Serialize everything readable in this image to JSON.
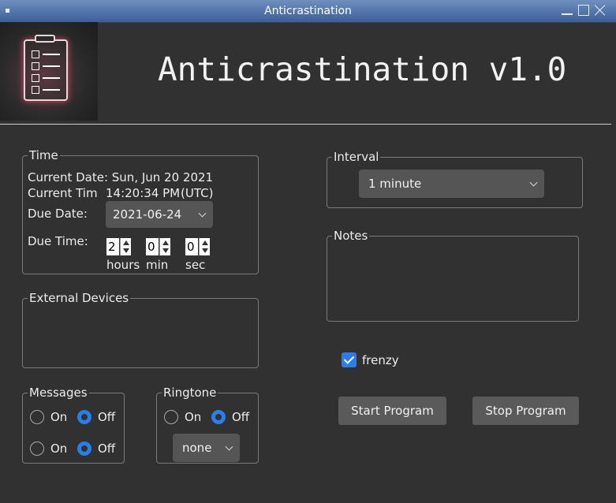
{
  "window": {
    "title": "Anticrastination"
  },
  "header": {
    "app_title": "Anticrastination v1.0",
    "logo_icon": "clipboard-checklist-icon"
  },
  "time": {
    "group_label": "Time",
    "current_date": "Current Date: Sun, Jun 20 2021",
    "current_time_label": "Current Tim",
    "current_time_value": "14:20:34 PM",
    "current_time_zone": "(UTC)",
    "due_date_label": "Due Date:",
    "due_date_value": "2021-06-24",
    "due_time_label": "Due Time:",
    "hours_value": "2",
    "minutes_value": "0",
    "seconds_value": "0",
    "hours_label": "hours",
    "minutes_label": "min",
    "seconds_label": "sec"
  },
  "external_devices": {
    "group_label": "External Devices"
  },
  "messages": {
    "group_label": "Messages",
    "row1_on_label": "On",
    "row1_off_label": "Off",
    "row1_selected": "Off",
    "row2_on_label": "On",
    "row2_off_label": "Off",
    "row2_selected": "Off"
  },
  "ringtone": {
    "group_label": "Ringtone",
    "on_label": "On",
    "off_label": "Off",
    "selected": "Off",
    "tone_value": "none"
  },
  "interval": {
    "group_label": "Interval",
    "selected_value": "1 minute"
  },
  "notes": {
    "group_label": "Notes"
  },
  "frenzy": {
    "label": "frenzy",
    "checked": true
  },
  "actions": {
    "start_label": "Start Program",
    "stop_label": "Stop Program"
  },
  "colors": {
    "background": "#313131",
    "accent": "#2b7de9",
    "titlebar": "#4f6fa6",
    "control": "#555555"
  }
}
